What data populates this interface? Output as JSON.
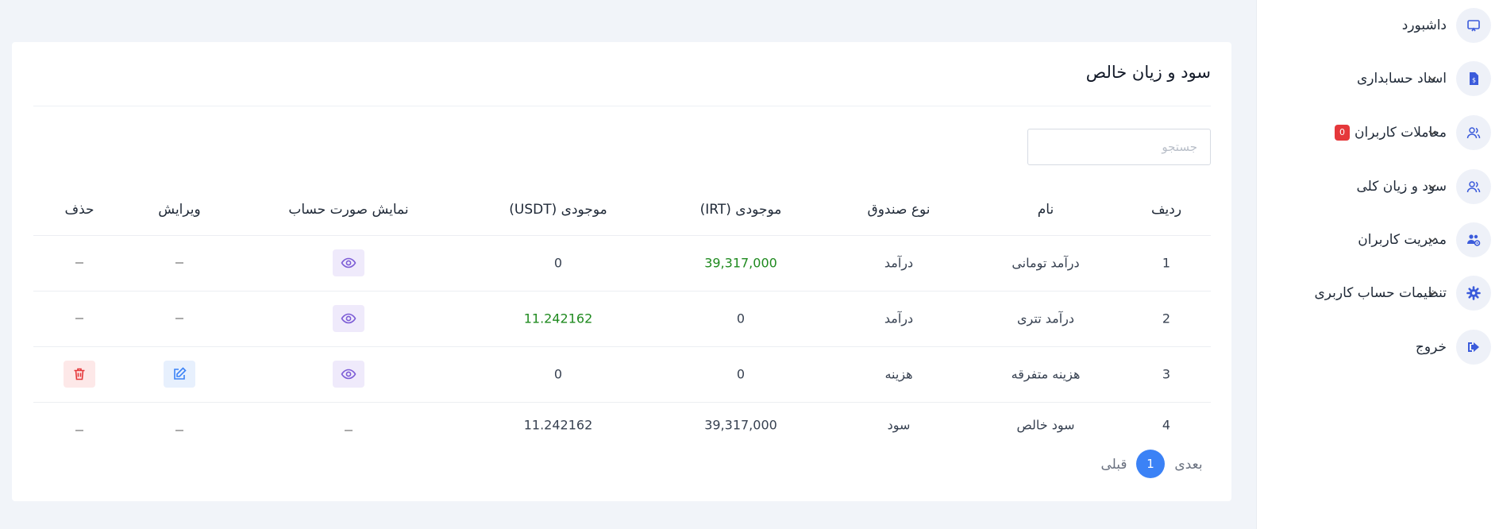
{
  "sidebar": {
    "items": [
      {
        "label": "داشبورد",
        "icon": "presentation-icon"
      },
      {
        "label": "اسناد حسابداری",
        "icon": "invoice-icon"
      },
      {
        "label": "معاملات کاربران",
        "icon": "users-icon",
        "badge": "0"
      },
      {
        "label": "سود و زیان کلی",
        "icon": "users-icon"
      },
      {
        "label": "مدیریت کاربران",
        "icon": "users-cog-icon"
      },
      {
        "label": "تنظیمات حساب کاربری",
        "icon": "gear-icon"
      },
      {
        "label": "خروج",
        "icon": "logout-icon"
      }
    ]
  },
  "card": {
    "title": "سود و زیان خالص",
    "search_placeholder": "جستجو"
  },
  "table": {
    "headers": [
      "ردیف",
      "نام",
      "نوع صندوق",
      "موجودی (IRT)",
      "موجودی (USDT)",
      "نمایش صورت حساب",
      "ویرایش",
      "حذف"
    ],
    "rows": [
      {
        "index": "1",
        "name": "درآمد تومانی",
        "type": "درآمد",
        "irt": "39,317,000",
        "usdt": "0"
      },
      {
        "index": "2",
        "name": "درآمد تتری",
        "type": "درآمد",
        "irt": "0",
        "usdt": "11.242162"
      },
      {
        "index": "3",
        "name": "هزینه متفرقه",
        "type": "هزینه",
        "irt": "0",
        "usdt": "0"
      },
      {
        "index": "4",
        "name": "سود خالص",
        "type": "سود",
        "irt": "39,317,000",
        "usdt": "11.242162"
      }
    ]
  },
  "pagination": {
    "next": "بعدی",
    "current": "1",
    "prev": "قبلی"
  },
  "colors": {
    "accent": "#3b82f6",
    "positive": "#1f8a1f",
    "danger": "#e5383b"
  }
}
